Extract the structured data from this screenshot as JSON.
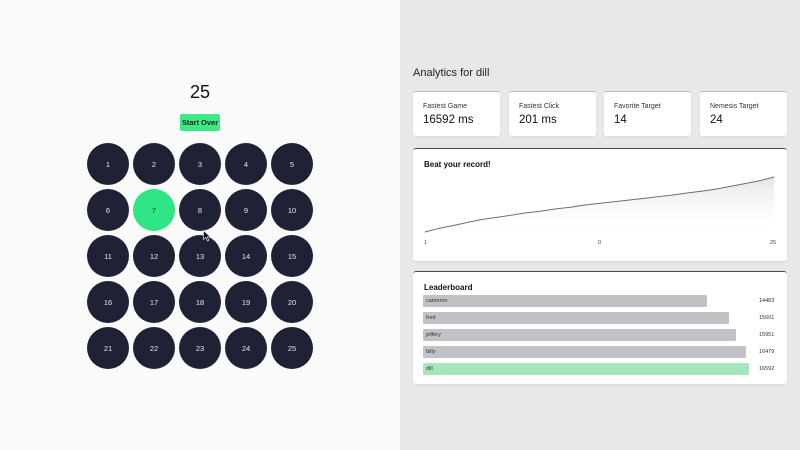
{
  "game": {
    "counter": "25",
    "start_over_label": "Start Over",
    "active_cell": "7",
    "cells": [
      "1",
      "2",
      "3",
      "4",
      "5",
      "6",
      "7",
      "8",
      "9",
      "10",
      "11",
      "12",
      "13",
      "14",
      "15",
      "16",
      "17",
      "18",
      "19",
      "20",
      "21",
      "22",
      "23",
      "24",
      "25"
    ]
  },
  "analytics": {
    "title": "Analytics for dill",
    "stats": [
      {
        "label": "Fastest Game",
        "value": "16592 ms"
      },
      {
        "label": "Fastest Click",
        "value": "201 ms"
      },
      {
        "label": "Favorite Target",
        "value": "14"
      },
      {
        "label": "Nemesis Target",
        "value": "24"
      }
    ],
    "chart_title": "Beat your record!",
    "leaderboard_title": "Leaderboard"
  },
  "chart_data": {
    "type": "area",
    "title": "Beat your record!",
    "x_ticks": [
      "1",
      "0",
      "25"
    ],
    "x": [
      1,
      2,
      3,
      4,
      5,
      6,
      7,
      8,
      9,
      10,
      11,
      12,
      13,
      14,
      15,
      16,
      17,
      18,
      19,
      20,
      21,
      22,
      23,
      24,
      25
    ],
    "values": [
      0.0,
      0.07,
      0.12,
      0.18,
      0.23,
      0.27,
      0.31,
      0.35,
      0.38,
      0.42,
      0.45,
      0.49,
      0.52,
      0.55,
      0.58,
      0.61,
      0.64,
      0.67,
      0.71,
      0.74,
      0.78,
      0.83,
      0.88,
      0.93,
      1.0
    ],
    "grid": false,
    "legend": "none"
  },
  "leaderboard": [
    {
      "name": "cameron",
      "score": "14483",
      "fraction": 0.87,
      "me": false
    },
    {
      "name": "fred",
      "score": "15601",
      "fraction": 0.94,
      "me": false
    },
    {
      "name": "jeffery",
      "score": "15951",
      "fraction": 0.96,
      "me": false
    },
    {
      "name": "billy",
      "score": "16479",
      "fraction": 0.99,
      "me": false
    },
    {
      "name": "dill",
      "score": "16592",
      "fraction": 1.0,
      "me": true
    }
  ],
  "colors": {
    "cell": "#1f2235",
    "cell_active": "#2fe585",
    "button": "#3ee882",
    "bar": "#c2c1c5",
    "bar_me": "#a5e6bd"
  }
}
